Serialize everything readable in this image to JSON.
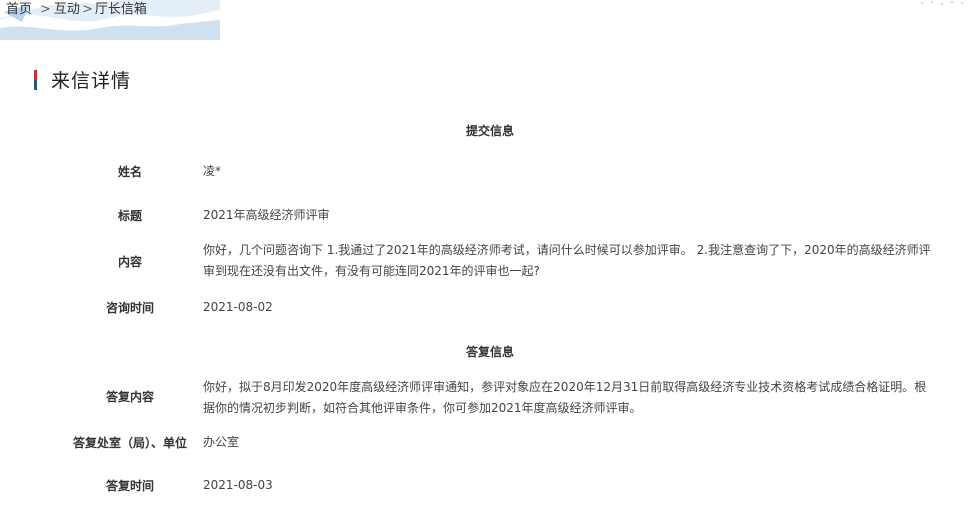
{
  "breadcrumb": {
    "home": "首页",
    "interact": "互动",
    "current": "厅长信箱",
    "separator": ">"
  },
  "section_title": "来信详情",
  "submit_section": {
    "heading": "提交信息",
    "name_label": "姓名",
    "name_value": "凌*",
    "title_label": "标题",
    "title_value": "2021年高级经济师评审",
    "content_label": "内容",
    "content_value": "你好，几个问题咨询下 1.我通过了2021年的高级经济师考试，请问什么时候可以参加评审。 2.我注意查询了下，2020年的高级经济师评审到现在还没有出文件，有没有可能连同2021年的评审也一起?",
    "time_label": "咨询时间",
    "time_value": "2021-08-02"
  },
  "reply_section": {
    "heading": "答复信息",
    "content_label": "答复内容",
    "content_value": "你好，拟于8月印发2020年度高级经济师评审通知，参评对象应在2020年12月31日前取得高级经济专业技术资格考试成绩合格证明。根据你的情况初步判断，如符合其他评审条件，你可参加2021年度高级经济师评审。",
    "office_label": "答复处室（局）、单位",
    "office_value": "办公室",
    "time_label": "答复时间",
    "time_value": "2021-08-03"
  },
  "colors": {
    "title_bar_top": "#c9302c",
    "title_bar_bottom": "#1f5a85"
  }
}
